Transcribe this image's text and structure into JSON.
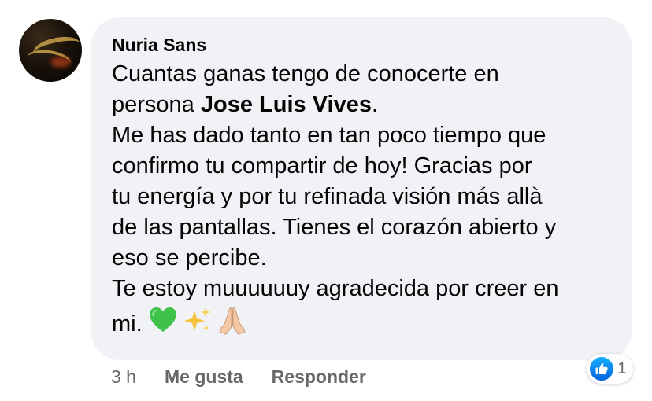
{
  "comment": {
    "author": "Nuria Sans",
    "lines": {
      "l1": "Cuantas ganas tengo de conocerte en",
      "l2_before": "persona ",
      "mention": "Jose Luis Vives",
      "l2_after": ".",
      "l3": "Me has dado tanto en tan poco tiempo que",
      "l4": "confirmo tu compartir de hoy! Gracias por",
      "l5": "tu energía y por tu refinada visión más allà",
      "l6": "de las pantallas. Tienes el corazón abierto y",
      "l7": "eso se percibe.",
      "l8": "Te estoy muuuuuuy agradecida por creer en",
      "l9": "mi."
    },
    "emojis": [
      "green-heart-icon",
      "sparkles-icon",
      "folded-hands-icon"
    ]
  },
  "actions": {
    "time": "3 h",
    "like": "Me gusta",
    "reply": "Responder"
  },
  "reactions": {
    "icon": "like-icon",
    "count": "1"
  },
  "colors": {
    "bubble_bg": "#f0f2f5",
    "text": "#050505",
    "secondary": "#65676b",
    "like_blue": "#0866ff"
  }
}
